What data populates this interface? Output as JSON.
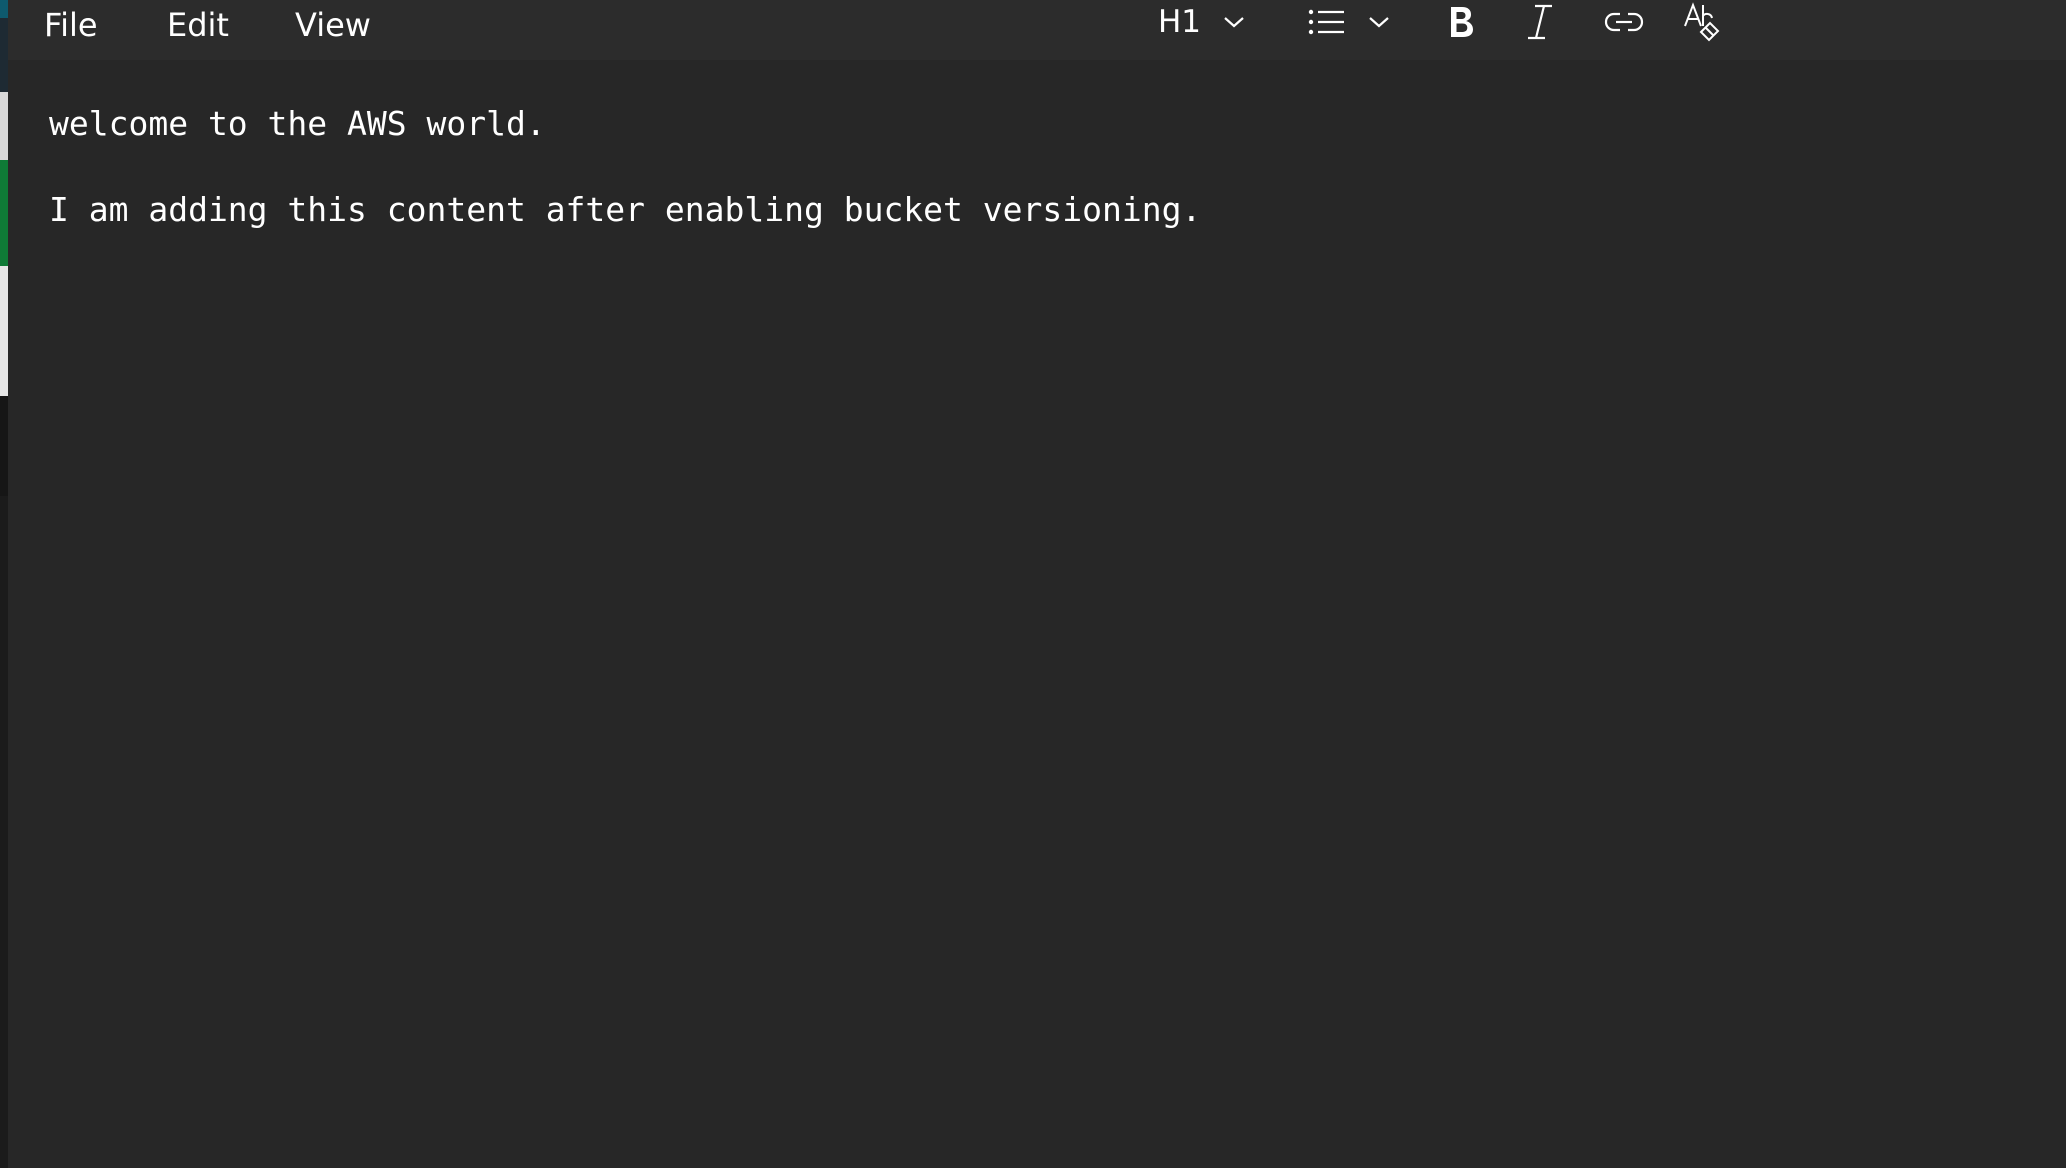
{
  "menu": {
    "file": "File",
    "edit": "Edit",
    "view": "View"
  },
  "toolbar": {
    "heading_level": "H1",
    "icons": [
      "chevron-down-icon",
      "bulleted-list-icon",
      "bold-icon",
      "italic-icon",
      "link-icon",
      "clear-formatting-icon"
    ]
  },
  "document": {
    "lines": [
      "welcome to the AWS world.",
      "I am adding this content after enabling bucket versioning."
    ]
  },
  "colors": {
    "background": "#272727",
    "toolbar": "#2c2c2c",
    "text": "#ffffff"
  }
}
